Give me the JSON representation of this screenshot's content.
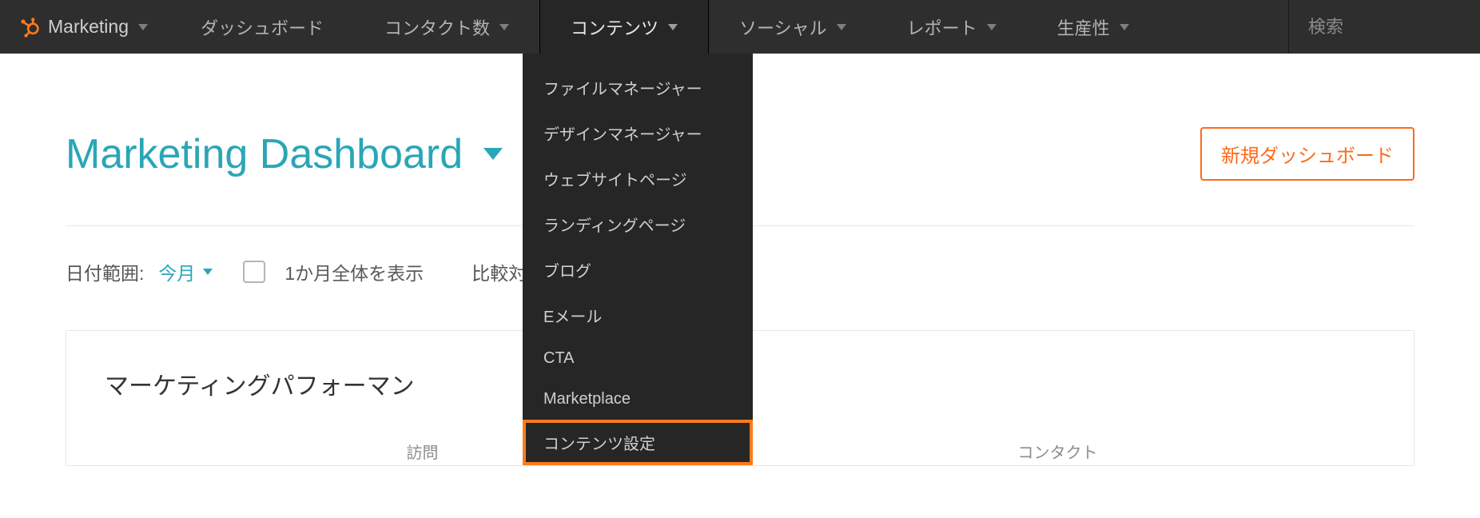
{
  "nav": {
    "brand": "Marketing",
    "items": [
      {
        "label": "ダッシュボード",
        "has_caret": false
      },
      {
        "label": "コンタクト数",
        "has_caret": true
      },
      {
        "label": "コンテンツ",
        "has_caret": true,
        "active": true
      },
      {
        "label": "ソーシャル",
        "has_caret": true
      },
      {
        "label": "レポート",
        "has_caret": true
      },
      {
        "label": "生産性",
        "has_caret": true
      }
    ],
    "search_placeholder": "検索"
  },
  "dropdown": {
    "items": [
      "ファイルマネージャー",
      "デザインマネージャー",
      "ウェブサイトページ",
      "ランディングページ",
      "ブログ",
      "Eメール",
      "CTA",
      "Marketplace",
      "コンテンツ設定"
    ],
    "highlight_index": 8
  },
  "page": {
    "title": "Marketing Dashboard",
    "new_button": "新規ダッシュボード"
  },
  "filters": {
    "date_label": "日付範囲:",
    "date_value": "今月",
    "check_label": "1か月全体を表示",
    "compare_label": "比較対"
  },
  "card": {
    "title": "マーケティングパフォーマン",
    "col1": "訪問",
    "col2": "コンタクト"
  }
}
